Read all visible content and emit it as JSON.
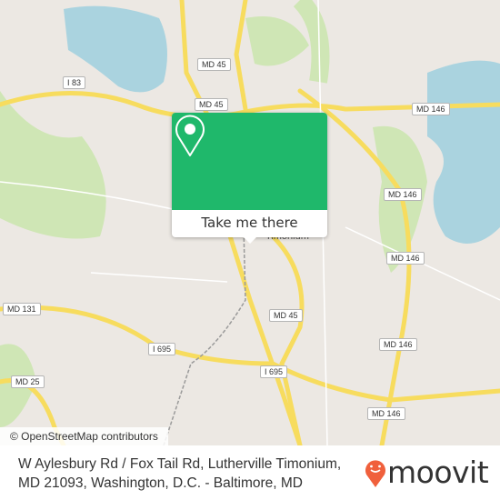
{
  "map": {
    "colors": {
      "land": "#ece8e3",
      "water": "#aad3df",
      "park": "#cfe6b5",
      "road": "#f7dc5e",
      "accent": "#1fb86b",
      "brand": "#f0603c"
    },
    "road_labels": [
      "MD 45",
      "I 83",
      "MD 45",
      "MD 146",
      "MD 146",
      "MD 146",
      "MD 131",
      "MD 45",
      "MD 146",
      "I 695",
      "I 695",
      "MD 25",
      "MD 146"
    ],
    "place_labels": [
      "Timonium"
    ],
    "attribution": "© OpenStreetMap contributors"
  },
  "popup": {
    "icon": "map-pin-icon",
    "button_label": "Take me there"
  },
  "footer": {
    "address_line1": "W Aylesbury Rd / Fox Tail Rd, Lutherville Timonium,",
    "address_line2": "MD 21093, Washington, D.C. - Baltimore, MD",
    "brand": "moovit"
  }
}
